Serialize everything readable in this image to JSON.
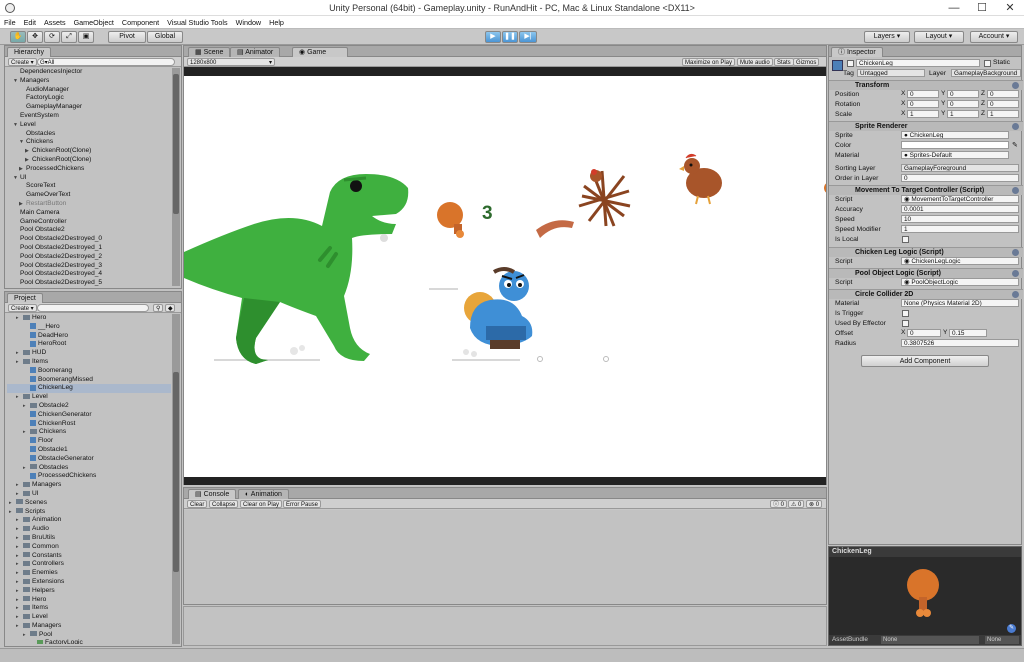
{
  "window": {
    "title": "Unity Personal (64bit) - Gameplay.unity - RunAndHit - PC, Mac & Linux Standalone <DX11>",
    "min": "—",
    "max": "☐",
    "close": "✕"
  },
  "menu": [
    "File",
    "Edit",
    "Assets",
    "GameObject",
    "Component",
    "Visual Studio Tools",
    "Window",
    "Help"
  ],
  "toolbar": {
    "pivot": "Pivot",
    "global": "Global",
    "layers": "Layers",
    "layout": "Layout",
    "account": "Account"
  },
  "hierarchy": {
    "tab": "Hierarchy",
    "create": "Create",
    "search_placeholder": "G▾All",
    "items": [
      "DependencesInjector",
      "Managers",
      "AudioManager",
      "FactoryLogic",
      "GameplayManager",
      "EventSystem",
      "Level",
      "Obstacles",
      "Chickens",
      "ChickenRoot(Clone)",
      "ChickenRoot(Clone)",
      "ProcessedChickens",
      "UI",
      "ScoreText",
      "GameOverText",
      "RestartButton",
      "Main Camera",
      "GameController",
      "Pool Obstacle2",
      "Pool Obstacle2Destroyed_0",
      "Pool Obstacle2Destroyed_1",
      "Pool Obstacle2Destroyed_2",
      "Pool Obstacle2Destroyed_3",
      "Pool Obstacle2Destroyed_4",
      "Pool Obstacle2Destroyed_5"
    ]
  },
  "project": {
    "tab": "Project",
    "create": "Create",
    "items": [
      "Hero",
      "__Hero",
      "DeadHero",
      "HeroRoot",
      "HUD",
      "Items",
      "Boomerang",
      "BoomerangMissed",
      "ChickenLeg",
      "Level",
      "Obstacle2",
      "ChickenGenerator",
      "ChickenRost",
      "Chickens",
      "Floor",
      "Obstacle1",
      "ObstacleGenerator",
      "Obstacles",
      "ProcessedChickens",
      "Managers",
      "UI",
      "Scenes",
      "Scripts",
      "Animation",
      "Audio",
      "BruUtils",
      "Common",
      "Constants",
      "Controllers",
      "Enemies",
      "Extensions",
      "Helpers",
      "Hero",
      "Items",
      "Level",
      "Managers",
      "Pool",
      "FactoryLogic"
    ],
    "selected": "ChickenLeg"
  },
  "game_view": {
    "tabs": [
      "Scene",
      "Animator",
      "Game"
    ],
    "resolution": "1280x800",
    "options": [
      "Maximize on Play",
      "Mute audio",
      "Stats",
      "Gizmos"
    ],
    "score": "3"
  },
  "console": {
    "tabs": [
      "Console",
      "Animation"
    ],
    "buttons": [
      "Clear",
      "Collapse",
      "Clear on Play",
      "Error Pause"
    ],
    "counts": [
      "0",
      "0",
      "0"
    ]
  },
  "inspector": {
    "tab": "Inspector",
    "object_name": "ChickenLeg",
    "static_label": "Static",
    "tag_label": "Tag",
    "tag_value": "Untagged",
    "layer_label": "Layer",
    "layer_value": "GameplayBackground",
    "transform": {
      "title": "Transform",
      "rows": [
        {
          "label": "Position",
          "x": "0",
          "y": "0",
          "z": "0"
        },
        {
          "label": "Rotation",
          "x": "0",
          "y": "0",
          "z": "0"
        },
        {
          "label": "Scale",
          "x": "1",
          "y": "1",
          "z": "1"
        }
      ]
    },
    "sprite_renderer": {
      "title": "Sprite Renderer",
      "sprite_label": "Sprite",
      "sprite_value": "ChickenLeg",
      "color_label": "Color",
      "material_label": "Material",
      "material_value": "Sprites-Default",
      "sorting_label": "Sorting Layer",
      "sorting_value": "GameplayForeground",
      "order_label": "Order in Layer",
      "order_value": "0"
    },
    "movement": {
      "title": "Movement To Target Controller (Script)",
      "script_label": "Script",
      "script_value": "MovementToTargetController",
      "accuracy_label": "Accuracy",
      "accuracy_value": "0.0001",
      "speed_label": "Speed",
      "speed_value": "10",
      "speed_mod_label": "Speed Modifier",
      "speed_mod_value": "1",
      "is_local_label": "Is Local"
    },
    "chicken_leg_logic": {
      "title": "Chicken Leg Logic (Script)",
      "script_label": "Script",
      "script_value": "ChickenLegLogic"
    },
    "pool_object_logic": {
      "title": "Pool Object Logic (Script)",
      "script_label": "Script",
      "script_value": "PoolObjectLogic"
    },
    "circle_collider": {
      "title": "Circle Collider 2D",
      "material_label": "Material",
      "material_value": "None (Physics Material 2D)",
      "trigger_label": "Is Trigger",
      "effector_label": "Used By Effector",
      "offset_label": "Offset",
      "offset_x": "0",
      "offset_y": "0.15",
      "radius_label": "Radius",
      "radius_value": "0.3807526"
    },
    "add_component": "Add Component",
    "preview_title": "ChickenLeg",
    "asset_bundle_label": "AssetBundle",
    "asset_bundle_value": "None",
    "asset_bundle_variant": "None"
  },
  "colors": {
    "dino": "#3fb03f",
    "dino_dark": "#2e8f2e",
    "hero": "#3f8fd6",
    "chicken": "#a8552a",
    "leg": "#d9742a",
    "score": "#2d6a2d",
    "selection": "#aab8cc"
  }
}
